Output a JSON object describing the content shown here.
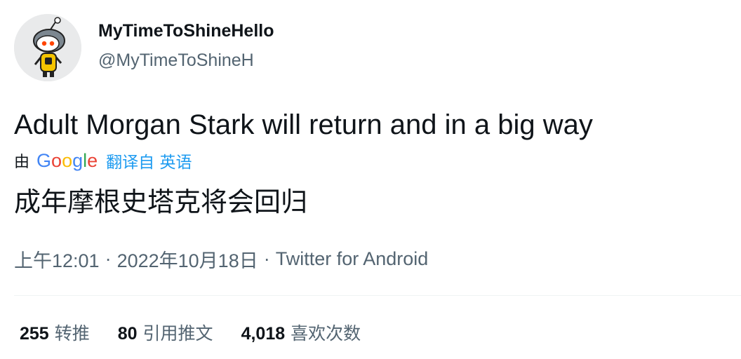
{
  "author": {
    "display_name": "MyTimeToShineHello",
    "handle": "@MyTimeToShineH",
    "avatar_icon": "snoo-avatar-icon"
  },
  "tweet": {
    "text": "Adult Morgan Stark will return and in a big way",
    "translated_text": "成年摩根史塔克将会回归"
  },
  "translation": {
    "by_label": "由",
    "provider_letters": [
      {
        "char": "G",
        "color": "#4285F4"
      },
      {
        "char": "o",
        "color": "#EA4335"
      },
      {
        "char": "o",
        "color": "#FBBC05"
      },
      {
        "char": "g",
        "color": "#4285F4"
      },
      {
        "char": "l",
        "color": "#34A853"
      },
      {
        "char": "e",
        "color": "#EA4335"
      }
    ],
    "translate_link": "翻译自 英语"
  },
  "meta": {
    "time": "上午12:01",
    "separator": "·",
    "date": "2022年10月18日",
    "source": "Twitter for Android"
  },
  "stats": [
    {
      "count": "255",
      "label": "转推"
    },
    {
      "count": "80",
      "label": "引用推文"
    },
    {
      "count": "4,018",
      "label": "喜欢次数"
    }
  ],
  "colors": {
    "text_primary": "#0f1419",
    "text_secondary": "#536471",
    "link_blue": "#1d9bf0",
    "divider": "#eff3f4"
  }
}
